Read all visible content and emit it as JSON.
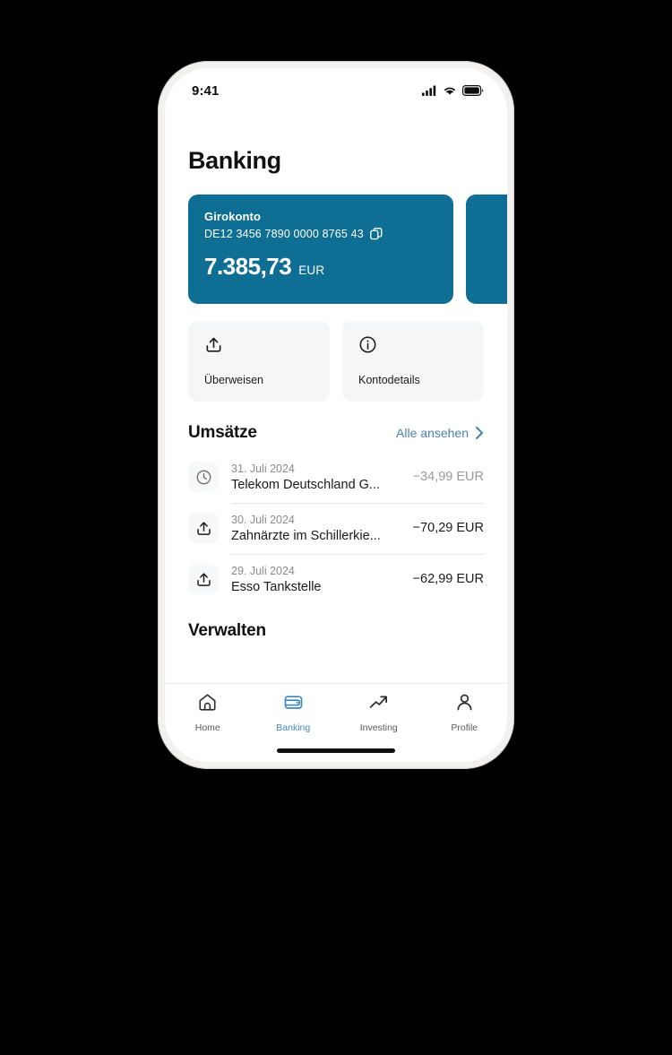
{
  "status_bar": {
    "time": "9:41",
    "icons": [
      "signal-icon",
      "wifi-icon",
      "battery-icon"
    ]
  },
  "header": {
    "title": "Banking"
  },
  "accounts": {
    "cards": [
      {
        "name": "Girokonto",
        "iban": "DE12 3456 7890 0000 8765 43",
        "copy_icon": "copy-icon",
        "balance": "7.385,73",
        "currency": "EUR"
      }
    ],
    "card_color": "#0f6e94"
  },
  "quick_actions": [
    {
      "label": "Überweisen",
      "icon": "share-export-icon"
    },
    {
      "label": "Kontodetails",
      "icon": "info-circle-icon"
    }
  ],
  "transactions_section": {
    "title": "Umsätze",
    "see_all_label": "Alle ansehen",
    "see_all_icon": "chevron-right-icon",
    "link_color": "#4b82ab",
    "items": [
      {
        "date": "31. Juli 2024",
        "name": "Telekom Deutschland G...",
        "amount": "−34,99 EUR",
        "icon": "clock-icon",
        "pending": true
      },
      {
        "date": "30. Juli 2024",
        "name": "Zahnärzte im Schillerkie...",
        "amount": "−70,29 EUR",
        "icon": "share-export-icon",
        "pending": false
      },
      {
        "date": "29. Juli 2024",
        "name": "Esso Tankstelle",
        "amount": "−62,99 EUR",
        "icon": "share-export-icon",
        "pending": false
      }
    ]
  },
  "manage_section": {
    "title": "Verwalten"
  },
  "tab_bar": {
    "active_color": "#3f89c0",
    "items": [
      {
        "label": "Home",
        "icon": "home-icon",
        "active": false
      },
      {
        "label": "Banking",
        "icon": "wallet-icon",
        "active": true
      },
      {
        "label": "Investing",
        "icon": "trending-up-icon",
        "active": false
      },
      {
        "label": "Profile",
        "icon": "person-icon",
        "active": false
      }
    ]
  }
}
